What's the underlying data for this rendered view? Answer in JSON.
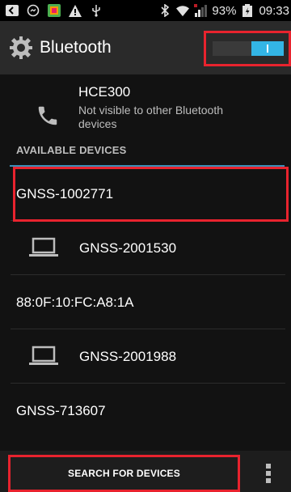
{
  "status_bar": {
    "icons_left": [
      "notification-icon",
      "messenger-icon",
      "app-icon",
      "warning-icon",
      "usb-icon"
    ],
    "icons_right": [
      "bluetooth-icon",
      "wifi-icon",
      "signal-icon"
    ],
    "battery_percent": "93%",
    "time": "09:33"
  },
  "app_bar": {
    "title": "Bluetooth",
    "icon": "gear-bluetooth-icon",
    "toggle_state": "on",
    "toggle_color": "#33b5e5"
  },
  "self_device": {
    "name": "HCE300",
    "description": "Not visible to other Bluetooth devices",
    "icon": "phone-icon"
  },
  "section": {
    "title": "AVAILABLE DEVICES"
  },
  "devices": [
    {
      "label": "GNSS-1002771",
      "has_icon": false
    },
    {
      "label": "GNSS-2001530",
      "has_icon": true,
      "icon": "laptop-icon"
    },
    {
      "label": "88:0F:10:FC:A8:1A",
      "has_icon": false
    },
    {
      "label": "GNSS-2001988",
      "has_icon": true,
      "icon": "laptop-icon"
    },
    {
      "label": "GNSS-713607",
      "has_icon": false
    }
  ],
  "bottom_bar": {
    "search_label": "SEARCH FOR DEVICES",
    "overflow_icon": "more-vert-icon"
  },
  "colors": {
    "highlight": "#e8232e",
    "accent": "#33b5e5",
    "section_divider": "#3b8fb8"
  }
}
